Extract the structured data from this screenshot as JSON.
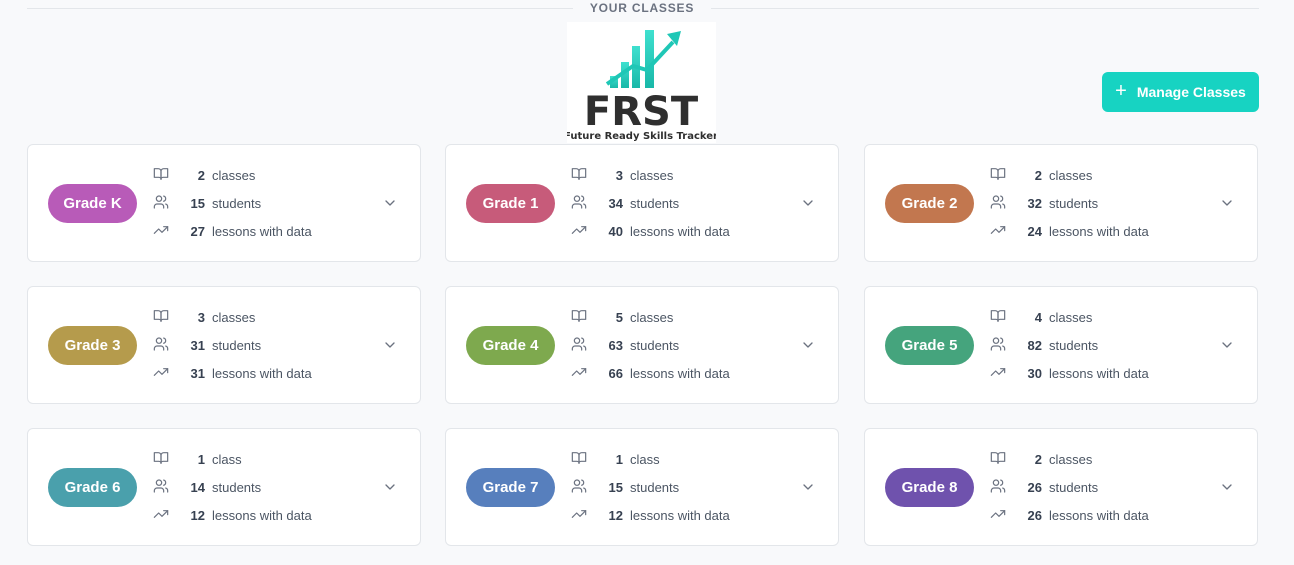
{
  "section": {
    "title": "YOUR CLASSES"
  },
  "logo": {
    "text": "FRST",
    "tagline": "Future Ready Skills Tracker"
  },
  "manage_button": {
    "label": "Manage Classes"
  },
  "grades": [
    {
      "name": "Grade K",
      "color": "#b85bb8",
      "classes": "2",
      "classes_label": "classes",
      "students": "15",
      "students_label": "students",
      "lessons": "27",
      "lessons_label": "lessons with data"
    },
    {
      "name": "Grade 1",
      "color": "#c75b7a",
      "classes": "3",
      "classes_label": "classes",
      "students": "34",
      "students_label": "students",
      "lessons": "40",
      "lessons_label": "lessons with data"
    },
    {
      "name": "Grade 2",
      "color": "#c2774f",
      "classes": "2",
      "classes_label": "classes",
      "students": "32",
      "students_label": "students",
      "lessons": "24",
      "lessons_label": "lessons with data"
    },
    {
      "name": "Grade 3",
      "color": "#b59b4c",
      "classes": "3",
      "classes_label": "classes",
      "students": "31",
      "students_label": "students",
      "lessons": "31",
      "lessons_label": "lessons with data"
    },
    {
      "name": "Grade 4",
      "color": "#7ea94e",
      "classes": "5",
      "classes_label": "classes",
      "students": "63",
      "students_label": "students",
      "lessons": "66",
      "lessons_label": "lessons with data"
    },
    {
      "name": "Grade 5",
      "color": "#45a47d",
      "classes": "4",
      "classes_label": "classes",
      "students": "82",
      "students_label": "students",
      "lessons": "30",
      "lessons_label": "lessons with data"
    },
    {
      "name": "Grade 6",
      "color": "#4aa0ac",
      "classes": "1",
      "classes_label": "class",
      "students": "14",
      "students_label": "students",
      "lessons": "12",
      "lessons_label": "lessons with data"
    },
    {
      "name": "Grade 7",
      "color": "#577fbd",
      "classes": "1",
      "classes_label": "class",
      "students": "15",
      "students_label": "students",
      "lessons": "12",
      "lessons_label": "lessons with data"
    },
    {
      "name": "Grade 8",
      "color": "#6f52ad",
      "classes": "2",
      "classes_label": "classes",
      "students": "26",
      "students_label": "students",
      "lessons": "26",
      "lessons_label": "lessons with data"
    }
  ],
  "icons": {
    "classes": "book-open-icon",
    "students": "users-icon",
    "lessons": "trending-up-icon",
    "expand": "chevron-down-icon",
    "add": "plus-icon"
  },
  "colors": {
    "accent": "#17d3c2",
    "logo_teal": "#1fc7b6",
    "logo_text": "#2f2f2f"
  }
}
